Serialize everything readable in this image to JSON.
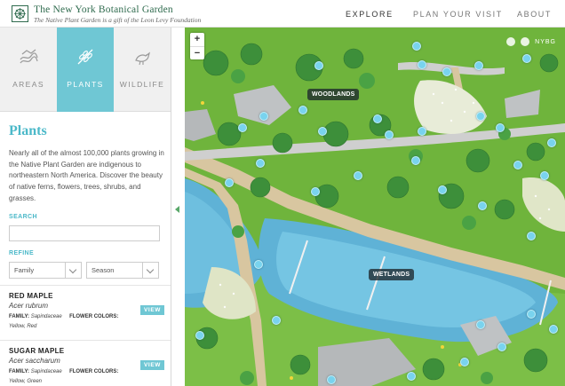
{
  "header": {
    "brand_title": "The New York Botanical Garden",
    "brand_subtitle": "The Native Plant Garden is a gift of the Leon Levy Foundation",
    "nav": [
      "EXPLORE",
      "PLAN YOUR VISIT",
      "ABOUT"
    ]
  },
  "tabs": [
    {
      "label": "AREAS",
      "icon": "areas-icon"
    },
    {
      "label": "PLANTS",
      "icon": "plants-icon"
    },
    {
      "label": "WILDLIFE",
      "icon": "wildlife-icon"
    }
  ],
  "panel": {
    "title": "Plants",
    "intro": "Nearly all of the almost 100,000 plants growing in the Native Plant Garden are indigenous to northeastern North America. Discover the beauty of native ferns, flowers, trees, shrubs, and grasses.",
    "search_label": "SEARCH",
    "search_value": "",
    "refine_label": "REFINE",
    "family_select": "Family",
    "season_select": "Season"
  },
  "plants": [
    {
      "name": "RED MAPLE",
      "latin": "Acer rubrum",
      "family_label": "FAMILY:",
      "family": "Sapindaceae",
      "colors_label": "FLOWER COLORS:",
      "colors": "Yellow, Red",
      "view": "VIEW"
    },
    {
      "name": "SUGAR MAPLE",
      "latin": "Acer saccharum",
      "family_label": "FAMILY:",
      "family": "Sapindaceae",
      "colors_label": "FLOWER COLORS:",
      "colors": "Yellow, Green",
      "view": "VIEW"
    }
  ],
  "map": {
    "zoom_in": "+",
    "zoom_out": "−",
    "social_text": "NYBG",
    "labels": {
      "woodlands": "WOODLANDS",
      "wetlands": "WETLANDS"
    }
  },
  "colors": {
    "accent": "#6fc7d4",
    "title": "#4cb9c9",
    "grass": "#6fb43c",
    "water": "#5fb2d6"
  }
}
